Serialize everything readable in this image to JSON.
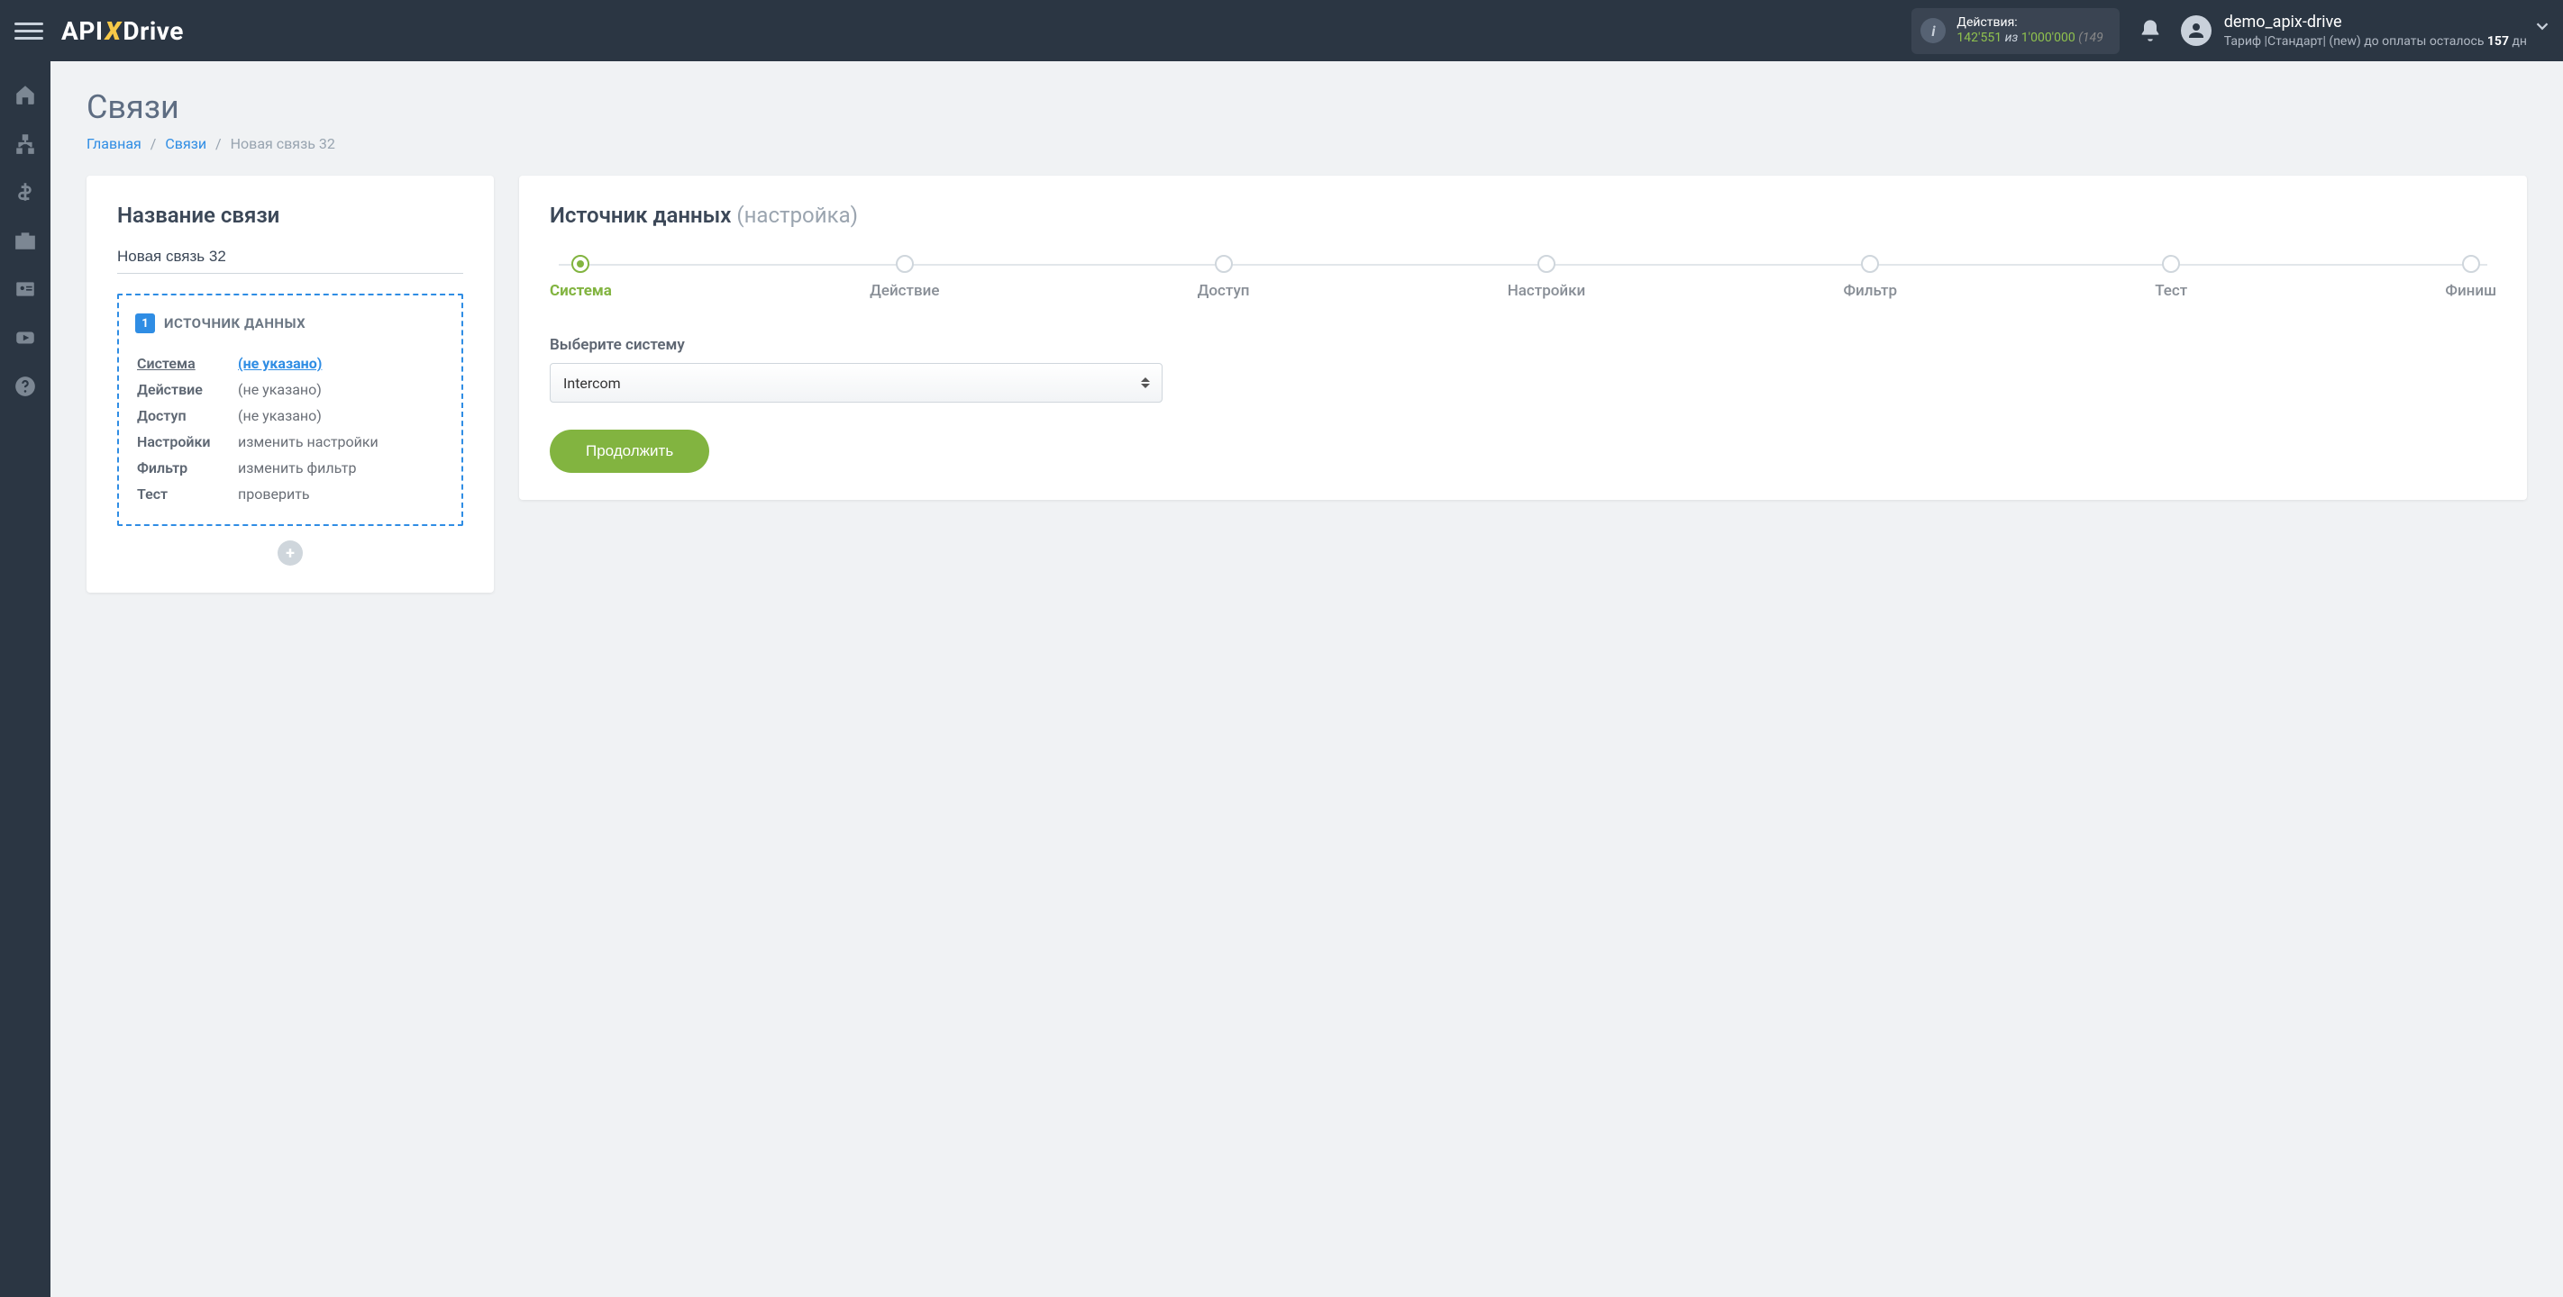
{
  "header": {
    "logo": {
      "api": "API",
      "x": "X",
      "drive": "Drive"
    },
    "actions": {
      "label": "Действия:",
      "count": "142'551",
      "iz": "из",
      "limit": "1'000'000",
      "rest": "(149"
    },
    "user": {
      "name": "demo_apix-drive",
      "tariff_pre": "Тариф |Стандарт| (new) до оплаты осталось ",
      "days": "157",
      "tariff_post": " дн"
    }
  },
  "page": {
    "title": "Связи",
    "crumbs": {
      "home": "Главная",
      "links": "Связи",
      "current": "Новая связь 32"
    }
  },
  "left": {
    "title": "Название связи",
    "name_value": "Новая связь 32",
    "src_title": "ИСТОЧНИК ДАННЫХ",
    "badge": "1",
    "rows": [
      {
        "k": "Система",
        "v": "(не указано)",
        "active": true
      },
      {
        "k": "Действие",
        "v": "(не указано)",
        "active": false
      },
      {
        "k": "Доступ",
        "v": "(не указано)",
        "active": false
      },
      {
        "k": "Настройки",
        "v": "изменить настройки",
        "active": false
      },
      {
        "k": "Фильтр",
        "v": "изменить фильтр",
        "active": false
      },
      {
        "k": "Тест",
        "v": "проверить",
        "active": false
      }
    ]
  },
  "right": {
    "title": "Источник данных",
    "title_muted": "(настройка)",
    "steps": [
      "Система",
      "Действие",
      "Доступ",
      "Настройки",
      "Фильтр",
      "Тест",
      "Финиш"
    ],
    "active_step": 0,
    "select_label": "Выберите систему",
    "select_value": "Intercom",
    "continue": "Продолжить"
  }
}
